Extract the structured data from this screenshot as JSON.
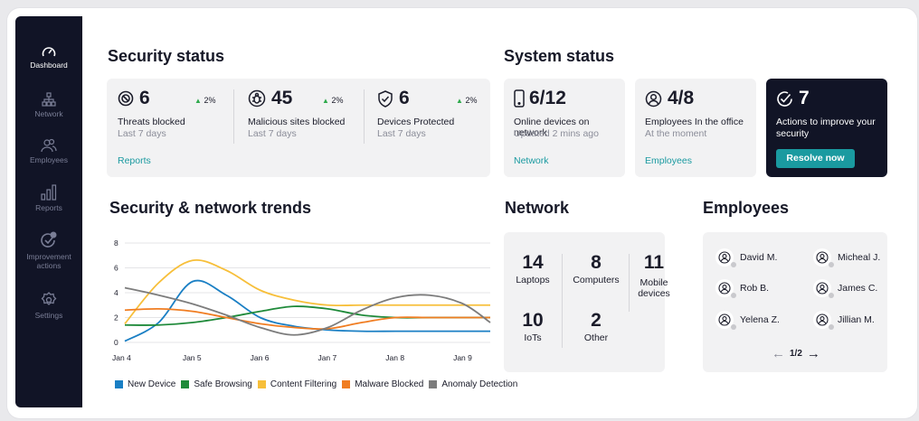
{
  "sidebar": {
    "items": [
      {
        "label": "Dashboard",
        "icon": "gauge-icon",
        "active": true
      },
      {
        "label": "Network",
        "icon": "network-icon"
      },
      {
        "label": "Employees",
        "icon": "users-icon"
      },
      {
        "label": "Reports",
        "icon": "bar-chart-icon"
      },
      {
        "label_line1": "Improvement",
        "label_line2": "actions",
        "icon": "check-badge-icon"
      },
      {
        "label": "Settings",
        "icon": "gear-icon"
      }
    ]
  },
  "security_status": {
    "title": "Security status",
    "stats": [
      {
        "value": "6",
        "pct": "2%",
        "label": "Threats blocked",
        "sub": "Last 7 days",
        "icon": "block-icon"
      },
      {
        "value": "45",
        "pct": "2%",
        "label": "Malicious sites blocked",
        "sub": "Last 7 days",
        "icon": "bug-icon"
      },
      {
        "value": "6",
        "pct": "2%",
        "label": "Devices Protected",
        "sub": "Last 7 days",
        "icon": "shield-check-icon"
      }
    ],
    "link": "Reports"
  },
  "system_status": {
    "title": "System status",
    "online": {
      "value": "6/12",
      "label": "Online devices on network",
      "sub": "Updated 2 mins ago",
      "link": "Network",
      "icon": "phone-icon"
    },
    "office": {
      "value": "4/8",
      "label": "Employees In the office",
      "sub": "At the moment",
      "link": "Employees",
      "icon": "user-circle-icon"
    },
    "actions": {
      "value": "7",
      "label": "Actions to improve your security",
      "button": "Resolve now",
      "icon": "check-circle-icon"
    }
  },
  "trends": {
    "title": "Security & network trends"
  },
  "chart_data": {
    "type": "line",
    "x": [
      "Jan 4",
      "Jan 5",
      "Jan 6",
      "Jan 7",
      "Jan 8",
      "Jan 9"
    ],
    "ylim": [
      0,
      8
    ],
    "yticks": [
      0,
      2,
      4,
      6,
      8
    ],
    "series": [
      {
        "name": "New Device",
        "color": "#1a7fc4",
        "x": [
          0,
          0.5,
          1,
          1.5,
          2,
          2.5,
          3,
          3.5,
          4,
          4.5,
          5,
          5.4
        ],
        "y": [
          0.1,
          1.6,
          4.9,
          3.8,
          2.0,
          1.3,
          1.0,
          0.9,
          0.9,
          0.9,
          0.9,
          0.9
        ]
      },
      {
        "name": "Safe Browsing",
        "color": "#1f8a3a",
        "x": [
          0,
          0.5,
          1,
          1.5,
          2,
          2.5,
          3,
          3.5,
          4,
          4.5,
          5,
          5.4
        ],
        "y": [
          1.4,
          1.4,
          1.6,
          2.0,
          2.5,
          2.9,
          2.7,
          2.2,
          2.0,
          2.0,
          2.0,
          2.0
        ]
      },
      {
        "name": "Content Filtering",
        "color": "#f7bf3a",
        "x": [
          0,
          0.5,
          1,
          1.5,
          2,
          2.5,
          3,
          3.5,
          4,
          4.5,
          5,
          5.4
        ],
        "y": [
          1.5,
          4.8,
          6.6,
          5.8,
          4.2,
          3.4,
          3.0,
          3.0,
          3.0,
          3.0,
          3.0,
          3.0
        ]
      },
      {
        "name": "Malware Blocked",
        "color": "#f07d22",
        "x": [
          0,
          0.5,
          1,
          1.5,
          2,
          2.5,
          3,
          3.5,
          4,
          4.5,
          5,
          5.4
        ],
        "y": [
          2.6,
          2.7,
          2.5,
          2.0,
          1.5,
          1.2,
          1.1,
          1.6,
          2.0,
          2.0,
          2.0,
          2.0
        ]
      },
      {
        "name": "Anomaly Detection",
        "color": "#7c7c7c",
        "x": [
          0,
          0.5,
          1,
          1.5,
          2,
          2.5,
          3,
          3.5,
          4,
          4.5,
          5,
          5.4
        ],
        "y": [
          4.4,
          3.8,
          3.1,
          2.2,
          1.2,
          0.6,
          1.2,
          2.6,
          3.6,
          3.8,
          3.1,
          1.6
        ]
      }
    ]
  },
  "network": {
    "title": "Network",
    "items": [
      {
        "value": "14",
        "label": "Laptops"
      },
      {
        "value": "8",
        "label": "Computers"
      },
      {
        "value": "11",
        "label_line1": "Mobile",
        "label_line2": "devices"
      },
      {
        "value": "10",
        "label": "IoTs"
      },
      {
        "value": "2",
        "label": "Other"
      }
    ]
  },
  "employees": {
    "title": "Employees",
    "people": [
      "David M.",
      "Micheal J.",
      "Rob B.",
      "James C.",
      "Yelena Z.",
      "Jillian M."
    ],
    "pager": "1/2"
  }
}
